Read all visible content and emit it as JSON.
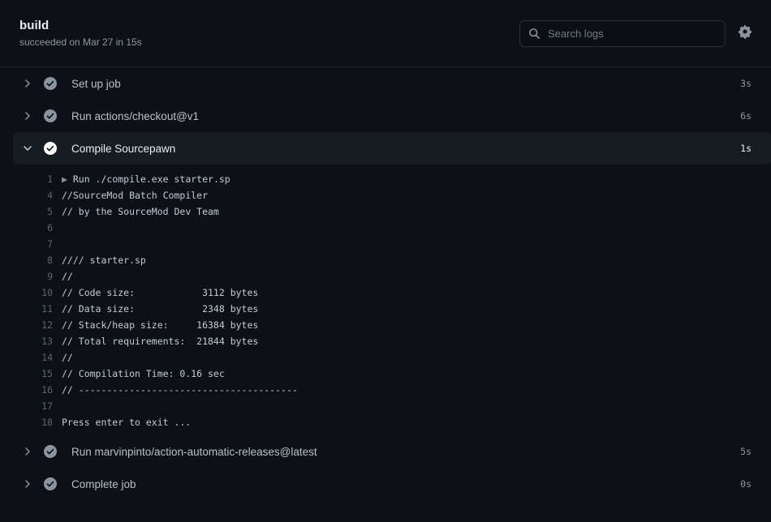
{
  "header": {
    "job_title": "build",
    "job_subtitle": "succeeded on Mar 27 in 15s",
    "search": {
      "placeholder": "Search logs",
      "value": "",
      "icon": "search-icon"
    },
    "settings_icon": "gear-icon"
  },
  "colors": {
    "page_background": "#0d1117",
    "row_highlight": "#171c23",
    "header_border": "#1b2028",
    "text_primary": "#e6edf3",
    "text_secondary": "#9198a1",
    "log_text": "#c3ccd6",
    "log_line_number": "#5b6673",
    "status_success": "#8b949e",
    "status_success_active": "#ffffff"
  },
  "steps": [
    {
      "label": "Set up job",
      "duration": "3s",
      "status": "success",
      "expanded": false,
      "chevron": "chevron-right-icon"
    },
    {
      "label": "Run actions/checkout@v1",
      "duration": "6s",
      "status": "success",
      "expanded": false,
      "chevron": "chevron-right-icon"
    },
    {
      "label": "Compile Sourcepawn",
      "duration": "1s",
      "status": "success",
      "expanded": true,
      "chevron": "chevron-down-icon"
    },
    {
      "label": "Run marvinpinto/action-automatic-releases@latest",
      "duration": "5s",
      "status": "success",
      "expanded": false,
      "chevron": "chevron-right-icon"
    },
    {
      "label": "Complete job",
      "duration": "0s",
      "status": "success",
      "expanded": false,
      "chevron": "chevron-right-icon"
    }
  ],
  "log": {
    "lines": [
      {
        "number": "1",
        "text": "Run ./compile.exe starter.sp",
        "group": true
      },
      {
        "number": "4",
        "text": "//SourceMod Batch Compiler",
        "group": false
      },
      {
        "number": "5",
        "text": "// by the SourceMod Dev Team",
        "group": false
      },
      {
        "number": "6",
        "text": "",
        "group": false
      },
      {
        "number": "7",
        "text": "",
        "group": false
      },
      {
        "number": "8",
        "text": "//// starter.sp",
        "group": false
      },
      {
        "number": "9",
        "text": "//",
        "group": false
      },
      {
        "number": "10",
        "text": "// Code size:            3112 bytes",
        "group": false
      },
      {
        "number": "11",
        "text": "// Data size:            2348 bytes",
        "group": false
      },
      {
        "number": "12",
        "text": "// Stack/heap size:     16384 bytes",
        "group": false
      },
      {
        "number": "13",
        "text": "// Total requirements:  21844 bytes",
        "group": false
      },
      {
        "number": "14",
        "text": "//",
        "group": false
      },
      {
        "number": "15",
        "text": "// Compilation Time: 0.16 sec",
        "group": false
      },
      {
        "number": "16",
        "text": "// ---------------------------------------",
        "group": false
      },
      {
        "number": "17",
        "text": "",
        "group": false
      },
      {
        "number": "18",
        "text": "Press enter to exit ...",
        "group": false
      }
    ]
  }
}
